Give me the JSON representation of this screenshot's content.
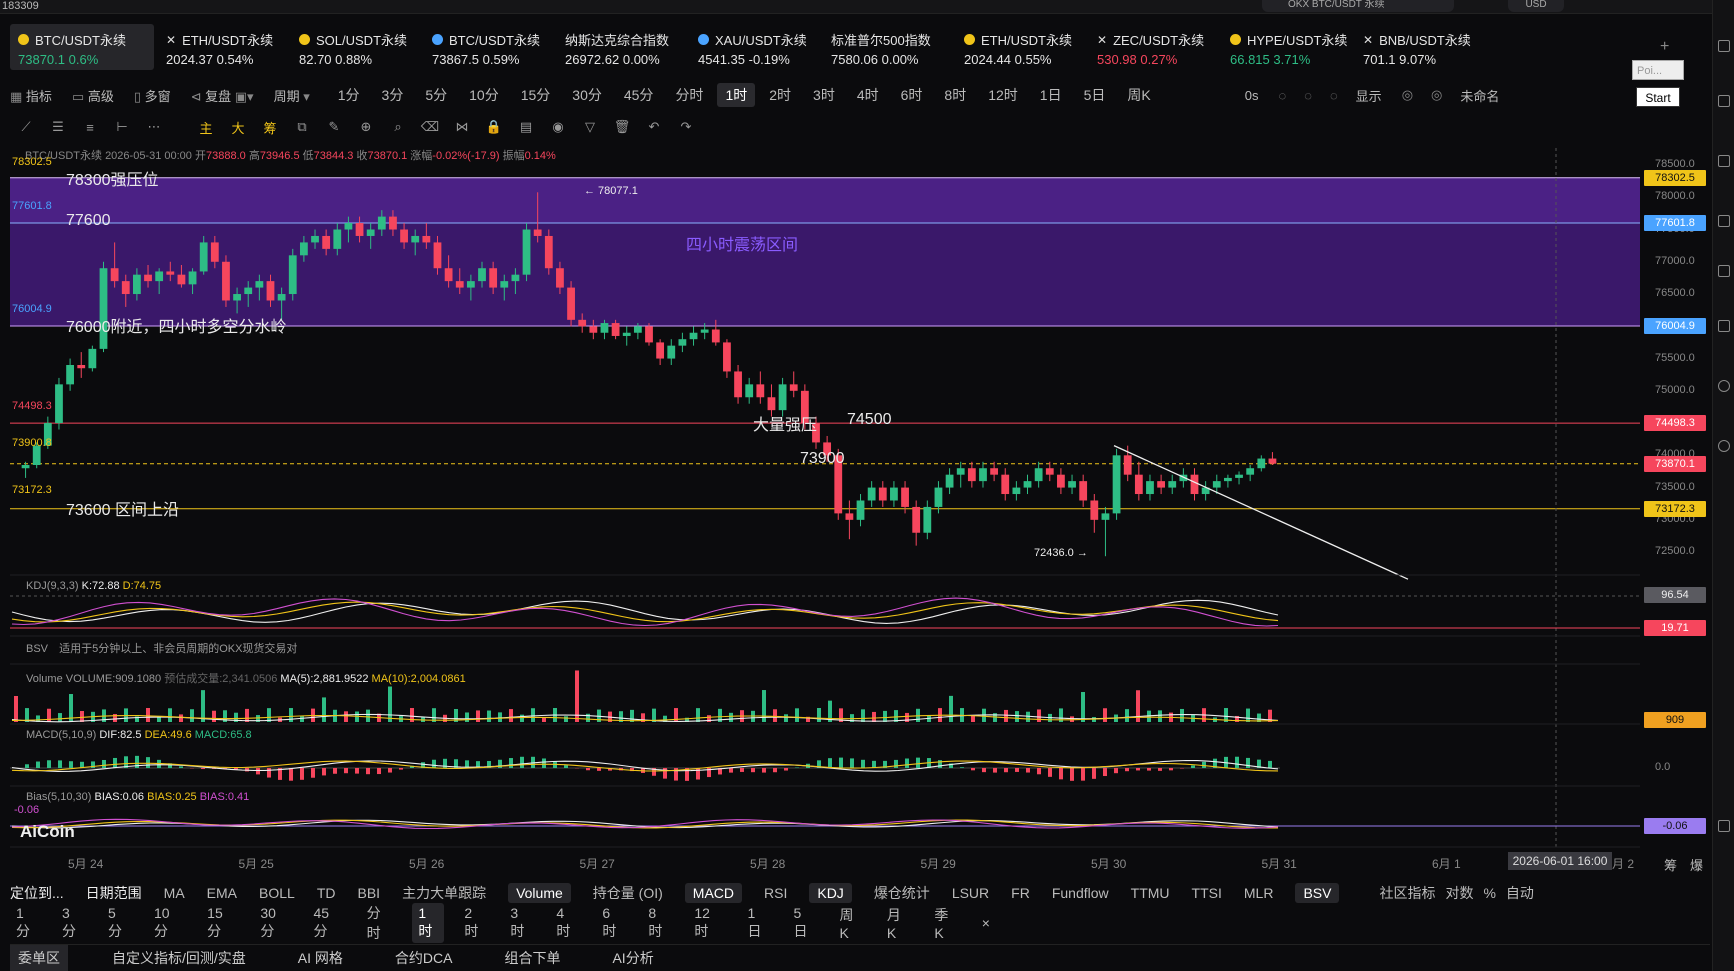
{
  "titlebar": {
    "left_text": "183309",
    "search": "OKX BTC/USDT 永续",
    "currency": "USD"
  },
  "tickers": [
    {
      "name": "BTC/USDT永续",
      "price": "73870.1",
      "chg": "0.6%",
      "dir": "up",
      "icon": "dot-yellow",
      "active": true
    },
    {
      "name": "ETH/USDT永续",
      "price": "2024.37",
      "chg": "0.54%",
      "dir": "wh",
      "icon": "close-icon"
    },
    {
      "name": "SOL/USDT永续",
      "price": "82.70",
      "chg": "0.88%",
      "dir": "wh",
      "icon": "dot-yellow"
    },
    {
      "name": "BTC/USDT永续",
      "price": "73867.5",
      "chg": "0.59%",
      "dir": "wh",
      "icon": "dot-blue"
    },
    {
      "name": "纳斯达克综合指数",
      "price": "26972.62",
      "chg": "0.00%",
      "dir": "wh",
      "icon": ""
    },
    {
      "name": "XAU/USDT永续",
      "price": "4541.35",
      "chg": "-0.19%",
      "dir": "wh",
      "icon": "dot-blue"
    },
    {
      "name": "标准普尔500指数",
      "price": "7580.06",
      "chg": "0.00%",
      "dir": "wh",
      "icon": ""
    },
    {
      "name": "ETH/USDT永续",
      "price": "2024.44",
      "chg": "0.55%",
      "dir": "wh",
      "icon": "dot-yellow"
    },
    {
      "name": "ZEC/USDT永续",
      "price": "530.98",
      "chg": "0.27%",
      "dir": "dn",
      "icon": "close-icon"
    },
    {
      "name": "HYPE/USDT永续",
      "price": "66.815",
      "chg": "3.71%",
      "dir": "up",
      "icon": "dot-yellow"
    },
    {
      "name": "BNB/USDT永续",
      "price": "701.1",
      "chg": "9.07%",
      "dir": "wh",
      "icon": "close-icon"
    }
  ],
  "toolbar1": {
    "items": [
      "指标",
      "高级",
      "多窗",
      "复盘",
      "周期"
    ],
    "periods": [
      "1分",
      "3分",
      "5分",
      "10分",
      "15分",
      "30分",
      "45分",
      "分时",
      "1时",
      "2时",
      "3时",
      "4时",
      "6时",
      "8时",
      "12时",
      "1日",
      "5日",
      "周K"
    ],
    "selected": "1时",
    "countdown": "0s",
    "show": "显示",
    "unnamed": "未命名",
    "poi": "Poi...",
    "start": "Start"
  },
  "toolbar2": {
    "labels": [
      "主",
      "大",
      "筹"
    ]
  },
  "chart_info": {
    "symbol": "BTC/USDT永续",
    "datetime": "2026-05-31 00:00",
    "open_label": "开",
    "open": "73888.0",
    "high_label": "高",
    "high": "73946.5",
    "low_label": "低",
    "low": "73844.3",
    "close_label": "收",
    "close": "73870.1",
    "chg_label": "涨幅",
    "chg": "-0.02%(-17.9)",
    "amp_label": "振幅",
    "amp": "0.14%"
  },
  "annotations": {
    "zone_label": "四小时震荡区间",
    "line1": "78300强压位",
    "line2": "77600",
    "line3": "76000附近，四小时多空分水岭",
    "line4": "大量强压",
    "line4b": "74500",
    "line5": "73900",
    "line6": "73600 区间上沿",
    "high_mark": "← 78077.1",
    "low_mark": "72436.0 →"
  },
  "left_levels": [
    "78302.5",
    "77601.8",
    "76004.9",
    "74498.3",
    "73900.8",
    "73172.3"
  ],
  "right_labels": [
    {
      "v": "78302.5",
      "c": "#f0c419"
    },
    {
      "v": "77601.8",
      "c": "#4aa3ff"
    },
    {
      "v": "76004.9",
      "c": "#4aa3ff"
    },
    {
      "v": "74498.3",
      "c": "#f6465d"
    },
    {
      "v": "73870.1",
      "c": "#f6465d"
    },
    {
      "v": "73172.3",
      "c": "#f0c419"
    }
  ],
  "y_ticks": [
    "78500.0",
    "78000.0",
    "77500.0",
    "77000.0",
    "76500.0",
    "76000.0",
    "75500.0",
    "75000.0",
    "74500.0",
    "74000.0",
    "73500.0",
    "73000.0",
    "72500.0"
  ],
  "panes": {
    "kdj": {
      "name": "KDJ(9,3,3)",
      "k": "K:72.88",
      "d": "D:74.75",
      "hi": "96.54",
      "lo": "19.71"
    },
    "bsv": {
      "name": "BSV",
      "desc": "适用于5分钟以上、非会员周期的OKX现货交易对"
    },
    "volume": {
      "name": "Volume",
      "vol": "VOLUME:909.1080",
      "est": "预估成交量:2,341.0506",
      "ma5": "MA(5):2,881.9522",
      "ma10": "MA(10):2,004.0861",
      "last": "909"
    },
    "macd": {
      "name": "MACD(5,10,9)",
      "dif": "DIF:82.5",
      "dea": "DEA:49.6",
      "macd": "MACD:65.8",
      "zero": "0.0"
    },
    "bias": {
      "name": "Bias(5,10,30)",
      "b1": "BIAS:0.06",
      "b2": "BIAS:0.25",
      "b3": "BIAS:0.41",
      "left": "-0.06",
      "last": "-0.06"
    }
  },
  "x_ticks": [
    "5月 24",
    "5月 25",
    "5月 26",
    "5月 27",
    "5月 28",
    "5月 29",
    "5月 30",
    "5月 31",
    "6月 1"
  ],
  "crosshair_time": "2026-06-01 16:00",
  "x_tail": "月 2",
  "logo": "AiCoin",
  "indicator_bar": {
    "left": [
      "定位到...",
      "日期范围"
    ],
    "items": [
      "MA",
      "EMA",
      "BOLL",
      "TD",
      "BBI",
      "主力大单跟踪",
      "Volume",
      "持仓量 (OI)",
      "MACD",
      "RSI",
      "KDJ",
      "爆仓统计",
      "LSUR",
      "FR",
      "Fundflow",
      "TTMU",
      "TTSI",
      "MLR",
      "BSV"
    ],
    "active": [
      "Volume",
      "MACD",
      "KDJ",
      "BSV"
    ],
    "right": [
      "社区指标",
      "对数",
      "%",
      "自动"
    ]
  },
  "period_bar": {
    "items": [
      "1分",
      "3分",
      "5分",
      "10分",
      "15分",
      "30分",
      "45分",
      "分时",
      "1时",
      "2时",
      "3时",
      "4时",
      "6时",
      "8时",
      "12时",
      "1日",
      "5日",
      "周K",
      "月K",
      "季K"
    ],
    "selected": "1时"
  },
  "bottom_tabs": {
    "items": [
      "委单区",
      "自定义指标/回测/实盘",
      "AI 网格",
      "合约DCA",
      "组合下单",
      "AI分析"
    ],
    "active": "委单区"
  },
  "right_side_extra": [
    "筹",
    "爆"
  ],
  "chart_data": {
    "type": "candlestick",
    "ylim": [
      72300,
      78500
    ],
    "candles": [
      [
        73800,
        73900,
        73650,
        73850
      ],
      [
        73850,
        74200,
        73800,
        74150
      ],
      [
        74150,
        74600,
        74100,
        74500
      ],
      [
        74500,
        75200,
        74400,
        75100
      ],
      [
        75100,
        75500,
        75000,
        75400
      ],
      [
        75400,
        75600,
        75200,
        75350
      ],
      [
        75350,
        75700,
        75300,
        75650
      ],
      [
        75650,
        77000,
        75600,
        76900
      ],
      [
        76900,
        77300,
        76600,
        76700
      ],
      [
        76700,
        76800,
        76300,
        76500
      ],
      [
        76500,
        76900,
        76400,
        76800
      ],
      [
        76800,
        76950,
        76600,
        76700
      ],
      [
        76700,
        76900,
        76500,
        76850
      ],
      [
        76850,
        77000,
        76700,
        76800
      ],
      [
        76800,
        76950,
        76600,
        76650
      ],
      [
        76650,
        76900,
        76500,
        76850
      ],
      [
        76850,
        77400,
        76800,
        77300
      ],
      [
        77300,
        77400,
        76900,
        77000
      ],
      [
        77000,
        77100,
        76300,
        76400
      ],
      [
        76400,
        76600,
        76200,
        76500
      ],
      [
        76500,
        76700,
        76300,
        76600
      ],
      [
        76600,
        76800,
        76400,
        76700
      ],
      [
        76700,
        76800,
        76300,
        76400
      ],
      [
        76400,
        76600,
        76100,
        76500
      ],
      [
        76500,
        77200,
        76400,
        77100
      ],
      [
        77100,
        77400,
        77000,
        77300
      ],
      [
        77300,
        77500,
        77200,
        77400
      ],
      [
        77400,
        77500,
        77100,
        77200
      ],
      [
        77200,
        77600,
        77100,
        77500
      ],
      [
        77500,
        77700,
        77300,
        77600
      ],
      [
        77600,
        77700,
        77300,
        77400
      ],
      [
        77400,
        77600,
        77200,
        77500
      ],
      [
        77500,
        77800,
        77400,
        77700
      ],
      [
        77700,
        77800,
        77400,
        77500
      ],
      [
        77500,
        77600,
        77200,
        77300
      ],
      [
        77300,
        77500,
        77100,
        77400
      ],
      [
        77400,
        77600,
        77200,
        77300
      ],
      [
        77300,
        77400,
        76800,
        76900
      ],
      [
        76900,
        77100,
        76600,
        76700
      ],
      [
        76700,
        76900,
        76500,
        76600
      ],
      [
        76600,
        76800,
        76400,
        76700
      ],
      [
        76700,
        77000,
        76600,
        76900
      ],
      [
        76900,
        77000,
        76500,
        76600
      ],
      [
        76600,
        76800,
        76400,
        76700
      ],
      [
        76700,
        76900,
        76500,
        76800
      ],
      [
        76800,
        77600,
        76700,
        77500
      ],
      [
        77500,
        78077,
        77300,
        77400
      ],
      [
        77400,
        77500,
        76800,
        76900
      ],
      [
        76900,
        77000,
        76500,
        76600
      ],
      [
        76600,
        76700,
        76000,
        76100
      ],
      [
        76100,
        76200,
        75900,
        76000
      ],
      [
        76000,
        76100,
        75800,
        75900
      ],
      [
        75900,
        76100,
        75800,
        76050
      ],
      [
        76050,
        76100,
        75800,
        75850
      ],
      [
        75850,
        76000,
        75700,
        75900
      ],
      [
        75900,
        76050,
        75800,
        76000
      ],
      [
        76000,
        76050,
        75700,
        75750
      ],
      [
        75750,
        75800,
        75400,
        75500
      ],
      [
        75500,
        75800,
        75400,
        75700
      ],
      [
        75700,
        75900,
        75600,
        75800
      ],
      [
        75800,
        76000,
        75700,
        75900
      ],
      [
        75900,
        76050,
        75800,
        75950
      ],
      [
        75950,
        76100,
        75700,
        75750
      ],
      [
        75750,
        75800,
        75200,
        75300
      ],
      [
        75300,
        75400,
        74800,
        74900
      ],
      [
        74900,
        75200,
        74800,
        75100
      ],
      [
        75100,
        75300,
        74800,
        74900
      ],
      [
        74900,
        75100,
        74600,
        74700
      ],
      [
        74700,
        75200,
        74600,
        75100
      ],
      [
        75100,
        75300,
        74900,
        75000
      ],
      [
        75000,
        75100,
        74400,
        74500
      ],
      [
        74500,
        74600,
        74100,
        74200
      ],
      [
        74200,
        74300,
        73900,
        74000
      ],
      [
        74000,
        74100,
        73000,
        73100
      ],
      [
        73100,
        73300,
        72700,
        73000
      ],
      [
        73000,
        73400,
        72900,
        73300
      ],
      [
        73300,
        73600,
        73200,
        73500
      ],
      [
        73500,
        73600,
        73200,
        73300
      ],
      [
        73300,
        73600,
        73200,
        73500
      ],
      [
        73500,
        73600,
        73100,
        73200
      ],
      [
        73200,
        73300,
        72600,
        72800
      ],
      [
        72800,
        73300,
        72700,
        73200
      ],
      [
        73200,
        73600,
        73100,
        73500
      ],
      [
        73500,
        73800,
        73400,
        73700
      ],
      [
        73700,
        73900,
        73500,
        73800
      ],
      [
        73800,
        73900,
        73500,
        73600
      ],
      [
        73600,
        73900,
        73500,
        73800
      ],
      [
        73800,
        73900,
        73600,
        73700
      ],
      [
        73700,
        73800,
        73300,
        73400
      ],
      [
        73400,
        73600,
        73300,
        73500
      ],
      [
        73500,
        73700,
        73400,
        73600
      ],
      [
        73600,
        73900,
        73500,
        73800
      ],
      [
        73800,
        73900,
        73600,
        73700
      ],
      [
        73700,
        73800,
        73400,
        73500
      ],
      [
        73500,
        73700,
        73400,
        73600
      ],
      [
        73600,
        73700,
        73200,
        73300
      ],
      [
        73300,
        73400,
        72800,
        73000
      ],
      [
        73000,
        73200,
        72436,
        73100
      ],
      [
        73100,
        74100,
        73000,
        74000
      ],
      [
        74000,
        74150,
        73600,
        73700
      ],
      [
        73700,
        73900,
        73300,
        73400
      ],
      [
        73400,
        73700,
        73300,
        73600
      ],
      [
        73600,
        73700,
        73400,
        73500
      ],
      [
        73500,
        73700,
        73400,
        73600
      ],
      [
        73600,
        73800,
        73500,
        73700
      ],
      [
        73700,
        73800,
        73300,
        73400
      ],
      [
        73400,
        73600,
        73300,
        73500
      ],
      [
        73500,
        73700,
        73400,
        73600
      ],
      [
        73600,
        73700,
        73500,
        73650
      ],
      [
        73650,
        73750,
        73550,
        73700
      ],
      [
        73700,
        73850,
        73600,
        73800
      ],
      [
        73800,
        74000,
        73750,
        73950
      ],
      [
        73950,
        74050,
        73850,
        73870
      ]
    ]
  }
}
